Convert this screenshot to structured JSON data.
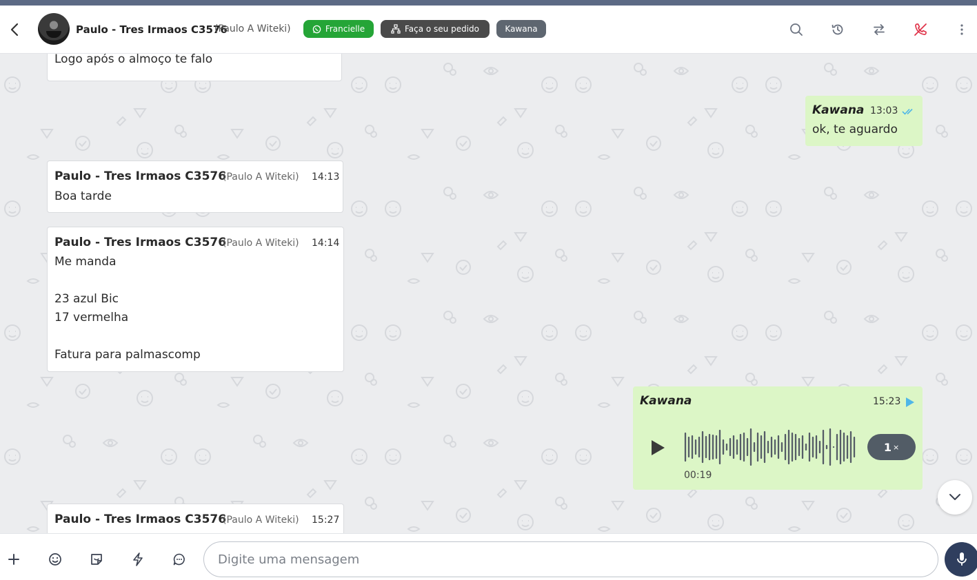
{
  "header": {
    "contact_name": "Paulo - Tres Irmaos C3576",
    "contact_sub": "(Paulo A Witeki)",
    "tags": [
      "Francielle",
      "Faça o seu pedido",
      "Kawana"
    ]
  },
  "messages": [
    {
      "text": "Logo após o almoço te falo"
    },
    {
      "sender": "Kawana",
      "time": "13:03",
      "text": "ok, te aguardo"
    },
    {
      "sender": "Paulo - Tres Irmaos C3576",
      "sender_sub": "(Paulo A Witeki)",
      "time": "14:13",
      "text": "Boa tarde"
    },
    {
      "sender": "Paulo - Tres Irmaos C3576",
      "sender_sub": "(Paulo A Witeki)",
      "time": "14:14",
      "text": "Me manda\n\n23 azul Bic\n17 vermelha\n\nFatura para palmascomp"
    },
    {
      "sender": "Kawana",
      "time": "15:23",
      "audio_duration": "00:19",
      "speed": "1",
      "speed_suffix": "×"
    },
    {
      "sender": "Paulo - Tres Irmaos C3576",
      "sender_sub": "(Paulo A Witeki)",
      "time": "15:27"
    }
  ],
  "composer": {
    "placeholder": "Digite uma mensagem"
  },
  "colors": {
    "accent": "#2f3e5e",
    "outgoing": "#dcf6c6",
    "tag_green": "#25a537",
    "read_tick": "#4fb6e8"
  }
}
